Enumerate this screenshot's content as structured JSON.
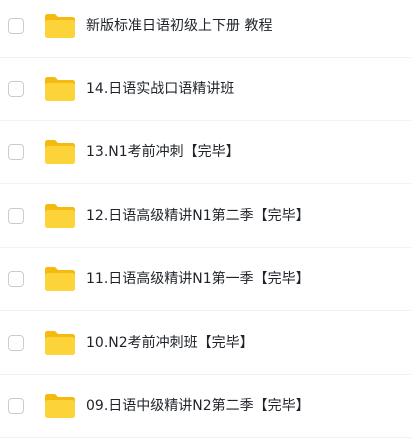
{
  "files": [
    {
      "name": "新版标准日语初级上下册 教程",
      "type": "folder-icon"
    },
    {
      "name": "14.日语实战口语精讲班",
      "type": "folder-icon"
    },
    {
      "name": "13.N1考前冲刺【完毕】",
      "type": "folder-icon"
    },
    {
      "name": "12.日语高级精讲N1第二季【完毕】",
      "type": "folder-icon"
    },
    {
      "name": "11.日语高级精讲N1第一季【完毕】",
      "type": "folder-icon"
    },
    {
      "name": "10.N2考前冲刺班【完毕】",
      "type": "folder-icon"
    },
    {
      "name": "09.日语中级精讲N2第二季【完毕】",
      "type": "folder-icon"
    }
  ],
  "colors": {
    "folder_back": "#f5b90f",
    "folder_front": "#fdd33a",
    "text": "#1f2329",
    "checkbox_border": "#c9ccd2",
    "divider": "#f1f2f4"
  }
}
